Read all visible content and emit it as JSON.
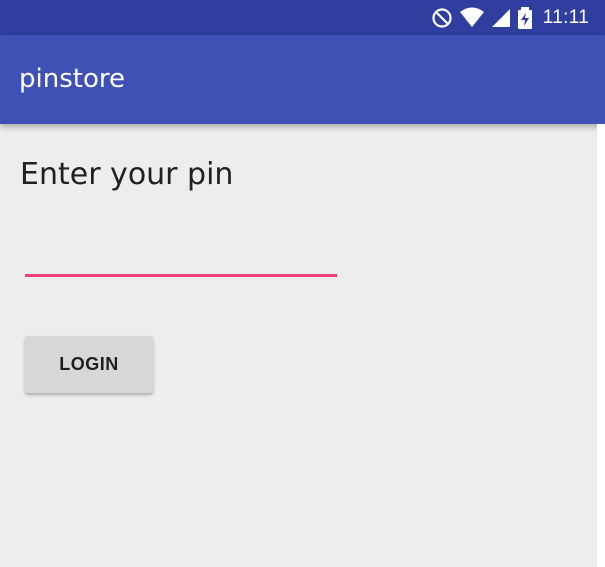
{
  "status_bar": {
    "time": "11:11",
    "icons": [
      "do-not-disturb-icon",
      "wifi-icon",
      "signal-icon",
      "battery-charging-icon"
    ],
    "color": "#303f9f"
  },
  "app_bar": {
    "title": "pinstore",
    "color": "#3f51b5"
  },
  "main": {
    "prompt": "Enter your pin",
    "pin_input": {
      "value": "",
      "accent_color": "#ec407a"
    },
    "login_button": {
      "label": "LOGIN"
    }
  }
}
